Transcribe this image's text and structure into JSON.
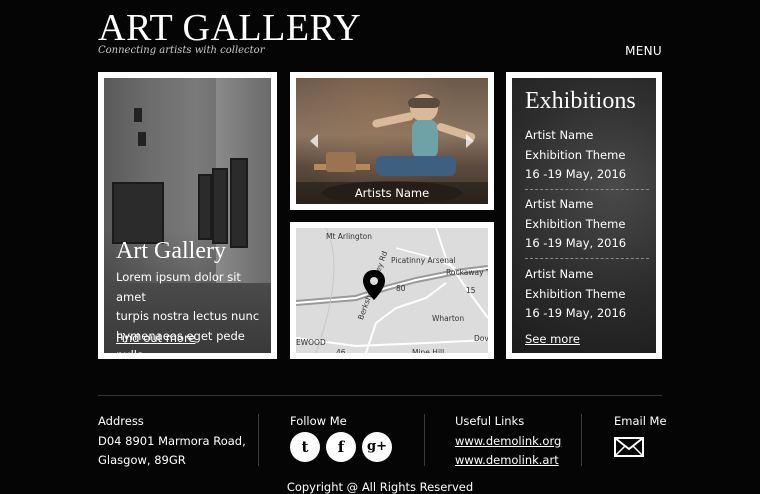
{
  "header": {
    "title": "ART GALLERY",
    "tagline": "Connecting artists with collector",
    "menu": "MENU"
  },
  "gallery": {
    "heading": "Art Gallery",
    "text_lines": [
      "Lorem ipsum dolor sit amet",
      "turpis nostra  lectus nunc",
      "hymenaeos eget pede nulla"
    ],
    "link": "Find out more"
  },
  "slider": {
    "caption": "Artists Name"
  },
  "map": {
    "labels": [
      "Mt Arlington",
      "Picatinny Arsenal",
      "Rockaway Towns",
      "80",
      "15",
      "Wharton",
      "Berkshire Valley Rd",
      "46",
      "Mine Hill",
      "Dove",
      "EWOOD"
    ]
  },
  "exhibitions": {
    "title": "Exhibitions",
    "items": [
      {
        "artist": "Artist Name",
        "theme": "Exhibition Theme",
        "date": "16 -19 May, 2016"
      },
      {
        "artist": "Artist Name",
        "theme": "Exhibition Theme",
        "date": "16 -19 May, 2016"
      },
      {
        "artist": "Artist Name",
        "theme": "Exhibition Theme",
        "date": "16 -19 May, 2016"
      }
    ],
    "see_more": "See more"
  },
  "footer": {
    "address_title": "Address",
    "address_line1": "D04 8901 Marmora Road,",
    "address_line2": "Glasgow, 89GR",
    "follow_title": "Follow Me",
    "social_icons": [
      "twitter-icon",
      "facebook-icon",
      "google-plus-icon"
    ],
    "social_glyphs": [
      "t",
      "f",
      "g+"
    ],
    "links_title": "Useful Links",
    "links": [
      "www.demolink.org",
      "www.demolink.art"
    ],
    "email_title": "Email Me",
    "copyright": "Copyright @ All Rights Reserved"
  },
  "colors": {
    "background": "#050505",
    "panel_border": "#ffffff",
    "text": "#ffffff"
  }
}
